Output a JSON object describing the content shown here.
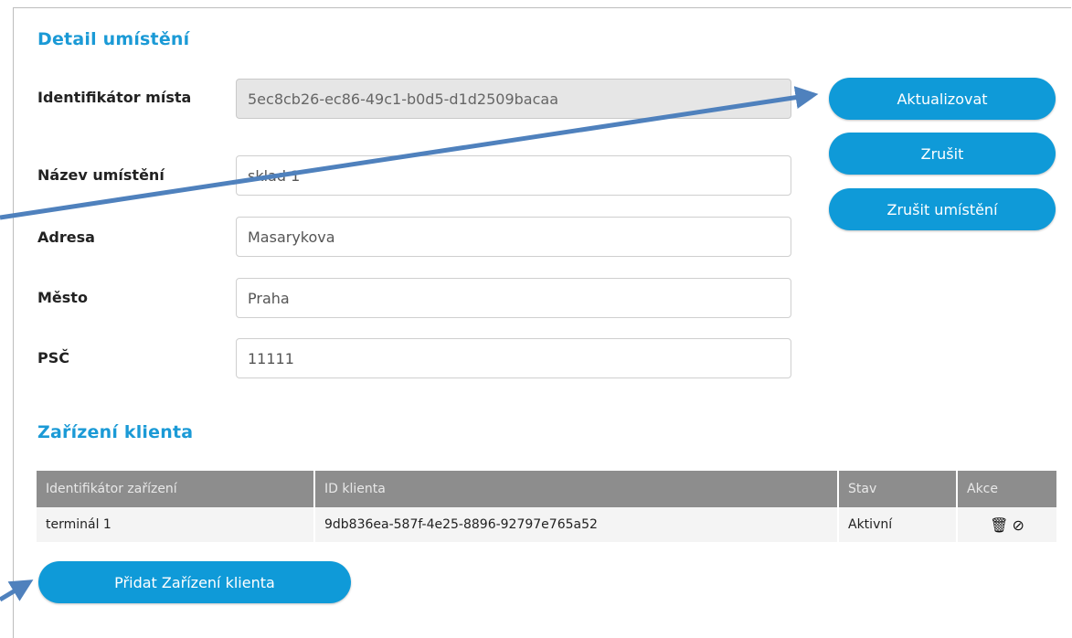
{
  "location": {
    "title": "Detail umístění",
    "fields": {
      "identifier": {
        "label": "Identifikátor místa",
        "value": "5ec8cb26-ec86-49c1-b0d5-d1d2509bacaa"
      },
      "name": {
        "label": "Název umístění",
        "value": "sklad 1"
      },
      "address": {
        "label": "Adresa",
        "value": "Masarykova"
      },
      "city": {
        "label": "Město",
        "value": "Praha"
      },
      "zip": {
        "label": "PSČ",
        "value": "11111"
      }
    },
    "buttons": {
      "update": "Aktualizovat",
      "cancel": "Zrušit",
      "cancel_location": "Zrušit umístění"
    }
  },
  "devices": {
    "title": "Zařízení klienta",
    "columns": [
      "Identifikátor zařízení",
      "ID klienta",
      "Stav",
      "Akce"
    ],
    "rows": [
      {
        "device_id": "terminál 1",
        "client_id": "9db836ea-587f-4e25-8896-92797e765a52",
        "status": "Aktivní",
        "actions": [
          "trash-icon",
          "block-icon"
        ]
      }
    ],
    "add_button": "Přidat Zařízení klienta"
  },
  "colors": {
    "accent": "#1b9ad6",
    "button": "#0f9ad8",
    "table_header": "#8d8d8d",
    "annotation_arrow": "#4f81bd"
  }
}
